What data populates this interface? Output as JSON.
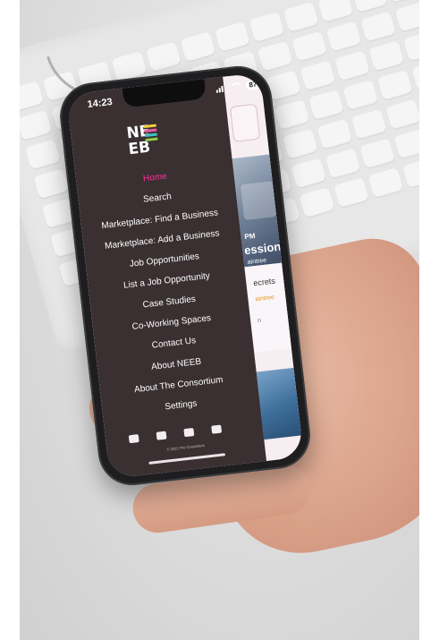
{
  "status_bar": {
    "time": "14:23",
    "battery": "87"
  },
  "logo": {
    "text_line1": "NE",
    "text_line2": "EB",
    "bar_colors": [
      "#f2d23d",
      "#e65aa5",
      "#3fbfbf",
      "#8fd04b"
    ]
  },
  "menu": {
    "items": [
      {
        "label": "Home",
        "active": true
      },
      {
        "label": "Search"
      },
      {
        "label": "Marketplace: Find a Business"
      },
      {
        "label": "Marketplace: Add a Business"
      },
      {
        "label": "Job Opportunities"
      },
      {
        "label": "List a Job Opportunity"
      },
      {
        "label": "Case Studies"
      },
      {
        "label": "Co-Working Spaces"
      },
      {
        "label": "Contact Us"
      },
      {
        "label": "About NEEB"
      },
      {
        "label": "About The Consortium"
      },
      {
        "label": "Settings"
      }
    ],
    "socials": [
      "facebook-icon",
      "instagram-icon",
      "linkedin-icon",
      "email-icon"
    ],
    "copyright": "© 2023 The Consortium"
  },
  "content": {
    "time_fragment": "PM",
    "headline_fragment": "ession",
    "location_fragment": "aintree",
    "card_title_fragment": "ecrets",
    "card_meta_fragment": "aintree",
    "card_extra_fragment": "n"
  }
}
